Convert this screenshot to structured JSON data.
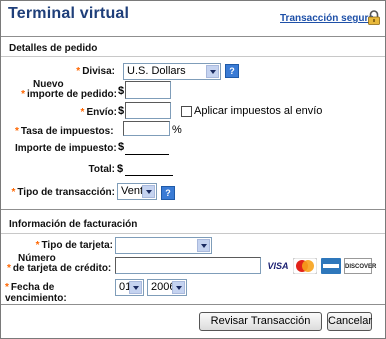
{
  "header": {
    "title": "Terminal virtual",
    "secure_link": "Transacción segura",
    "lock_icon": "lock-icon"
  },
  "order": {
    "section_title": "Detalles de pedido",
    "currency_label": "Divisa:",
    "currency_value": "U.S. Dollars",
    "amount_label_line1": "Nuevo",
    "amount_label_line2": "importe de pedido:",
    "currency_symbol": "$",
    "amount_value": "",
    "shipping_label": "Envío:",
    "shipping_value": "",
    "apply_tax_label": "Aplicar impuestos al envío",
    "tax_rate_label": "Tasa de impuestos:",
    "tax_rate_value": "",
    "percent": "%",
    "tax_amount_label": "Importe de impuesto:",
    "total_label": "Total:",
    "transaction_type_label": "Tipo de transacción:",
    "transaction_type_value": "Venta",
    "help_glyph": "?"
  },
  "billing": {
    "section_title": "Información de facturación",
    "card_type_label": "Tipo de tarjeta:",
    "card_type_value": "",
    "card_number_label_line1": "Número",
    "card_number_label_line2": "de tarjeta de crédito:",
    "card_number_value": "",
    "expiry_label": "Fecha de vencimiento:",
    "expiry_month": "01",
    "expiry_year": "2006",
    "cards": {
      "visa": "VISA",
      "mastercard": "MasterCard",
      "amex": "AMEX",
      "discover": "DISCOVER"
    }
  },
  "actions": {
    "review": "Revisar Transacción",
    "cancel": "Cancelar"
  },
  "colors": {
    "title": "#1f3f7a",
    "link": "#1e50a8",
    "required": "#ff6600",
    "help": "#3a7bd5"
  }
}
